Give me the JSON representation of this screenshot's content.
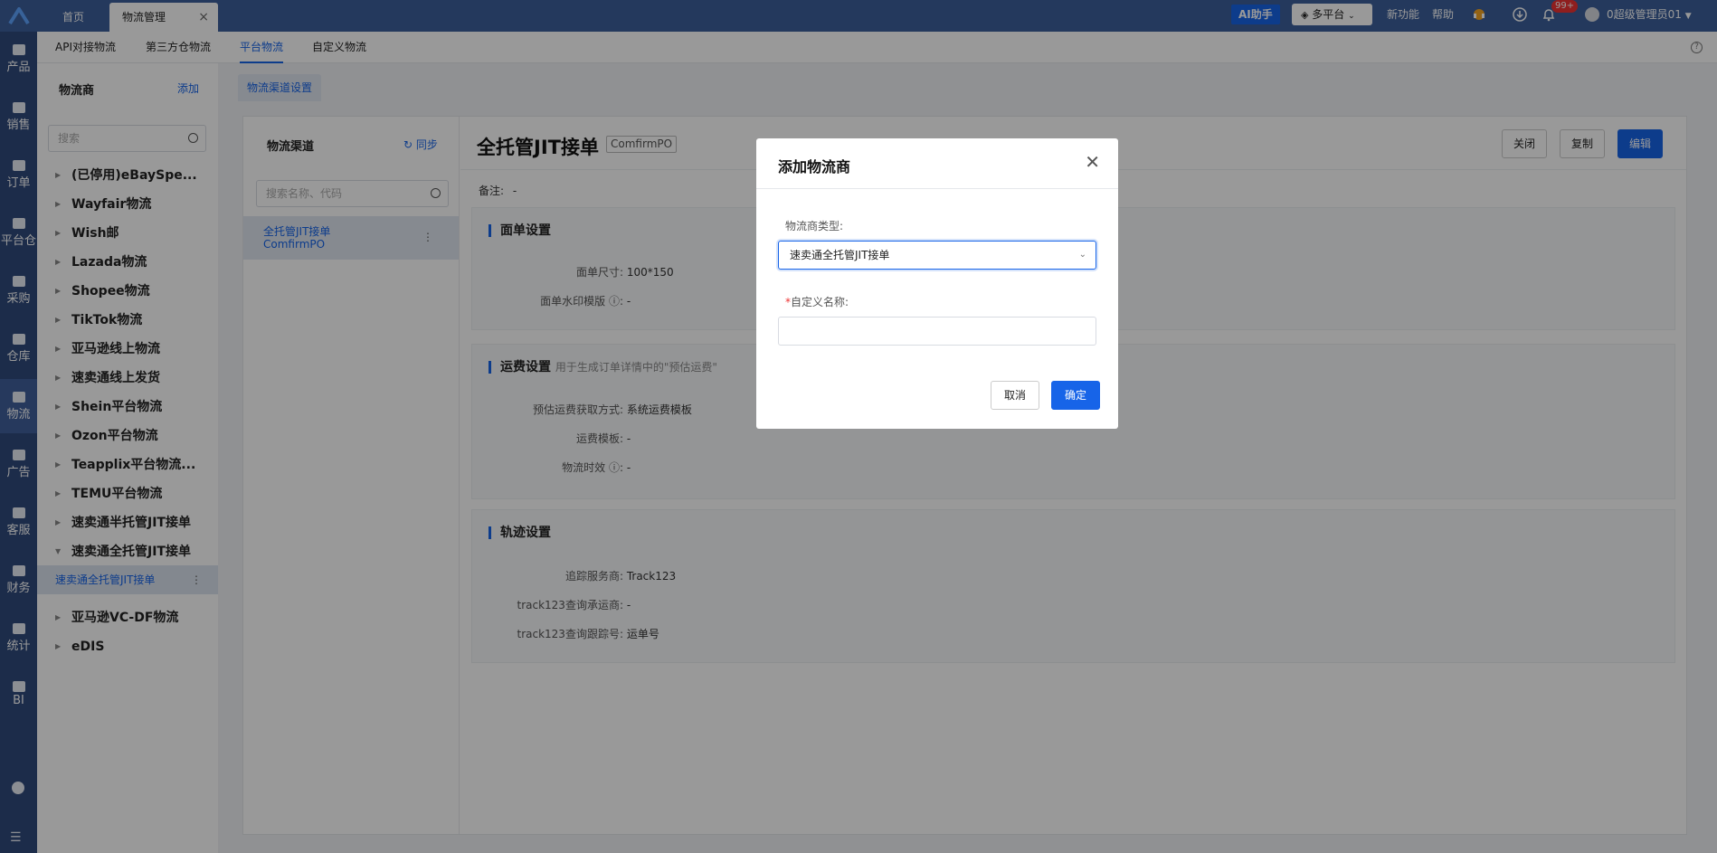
{
  "topbar": {
    "tabs": [
      "首页",
      "物流管理"
    ],
    "ai_label": "AI助手",
    "platform_label": "多平台",
    "links": [
      "新功能",
      "帮助"
    ],
    "notification_count": "99+",
    "user_name": "0超级管理员01"
  },
  "rail": [
    "产品",
    "销售",
    "订单",
    "平台仓",
    "采购",
    "仓库",
    "物流",
    "广告",
    "客服",
    "财务",
    "统计",
    "BI"
  ],
  "subnav": [
    "API对接物流",
    "第三方仓物流",
    "平台物流",
    "自定义物流"
  ],
  "carriers": {
    "title": "物流商",
    "add_label": "添加",
    "search_placeholder": "搜索",
    "items": [
      "(已停用)eBaySpe...",
      "Wayfair物流",
      "Wish邮",
      "Lazada物流",
      "Shopee物流",
      "TikTok物流",
      "亚马逊线上物流",
      "速卖通线上发货",
      "Shein平台物流",
      "Ozon平台物流",
      "Teapplix平台物流...",
      "TEMU平台物流",
      "速卖通半托管JIT接单",
      "速卖通全托管JIT接单"
    ],
    "selected_sub": "速卖通全托管JIT接单",
    "after_items": [
      "亚马逊VC-DF物流",
      "eDIS"
    ]
  },
  "main": {
    "tab_label": "物流渠道设置",
    "channel_title": "物流渠道",
    "sync_label": "同步",
    "channel_search_placeholder": "搜索名称、代码",
    "channel_item_name": "全托管JIT接单",
    "channel_item_code": "ComfirmPO",
    "detail_title": "全托管JIT接单",
    "detail_code": "ComfirmPO",
    "buttons": [
      "关闭",
      "复制",
      "编辑"
    ],
    "remark_label": "备注:",
    "remark_value": "-",
    "sections": {
      "label_settings": {
        "title": "面单设置",
        "rows": [
          {
            "label": "面单尺寸:",
            "value": "100*150"
          },
          {
            "label": "面单水印模版",
            "value": "-"
          }
        ]
      },
      "freight_settings": {
        "title": "运费设置",
        "hint": "用于生成订单详情中的\"预估运费\"",
        "rows": [
          {
            "label": "预估运费获取方式:",
            "value": "系统运费模板"
          },
          {
            "label": "运费模板:",
            "value": "-"
          },
          {
            "label": "物流时效",
            "value": "-"
          }
        ]
      },
      "track_settings": {
        "title": "轨迹设置",
        "rows": [
          {
            "label": "追踪服务商:",
            "value": "Track123"
          },
          {
            "label": "track123查询承运商:",
            "value": "-"
          },
          {
            "label": "track123查询跟踪号:",
            "value": "运单号"
          }
        ]
      }
    }
  },
  "modal": {
    "title": "添加物流商",
    "type_label": "物流商类型:",
    "type_value": "速卖通全托管JIT接单",
    "name_label": "自定义名称:",
    "name_value": "",
    "cancel_label": "取消",
    "confirm_label": "确定"
  },
  "colors": {
    "topbar": "#3c5f9b",
    "rail": "#2f4a7c",
    "primary": "#1764e8"
  }
}
